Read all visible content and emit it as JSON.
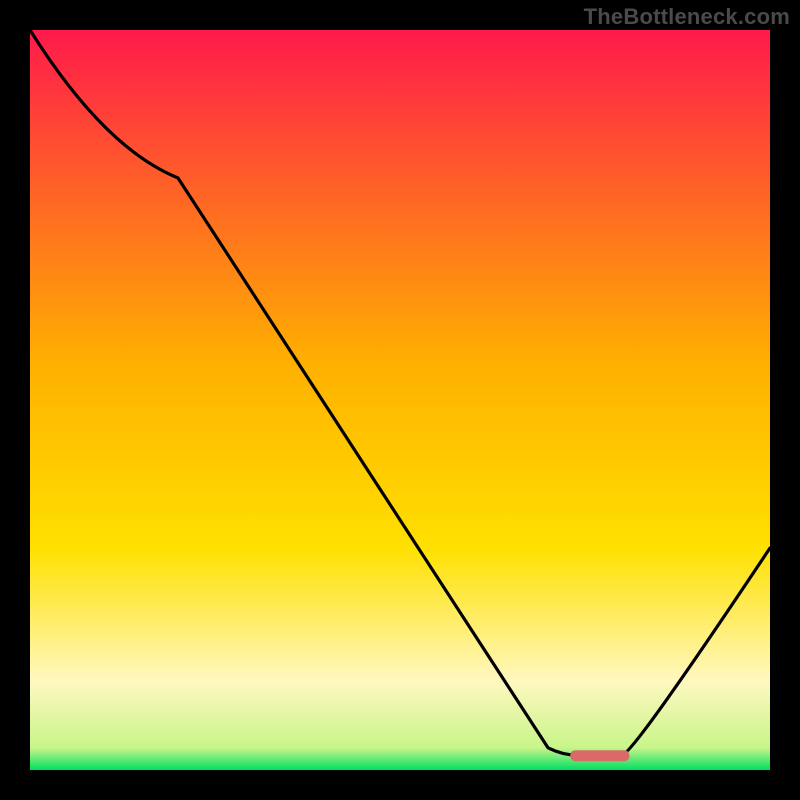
{
  "watermark": "TheBottleneck.com",
  "chart_data": {
    "type": "line",
    "title": "",
    "xlabel": "",
    "ylabel": "",
    "xlim": [
      0,
      100
    ],
    "ylim": [
      0,
      100
    ],
    "curve_points": [
      {
        "x": 0,
        "y": 100
      },
      {
        "x": 20,
        "y": 80
      },
      {
        "x": 70,
        "y": 3
      },
      {
        "x": 74,
        "y": 2
      },
      {
        "x": 80,
        "y": 2
      },
      {
        "x": 100,
        "y": 30
      }
    ],
    "flat_marker": {
      "x_start": 73,
      "x_end": 81,
      "y": 2
    },
    "colors": {
      "gradient_top": "#ff1a4b",
      "gradient_mid": "#ffd400",
      "gradient_cream": "#fff8c0",
      "gradient_bottom": "#00e060",
      "curve": "#000000",
      "marker": "#d86a6a",
      "frame": "#000000"
    }
  }
}
